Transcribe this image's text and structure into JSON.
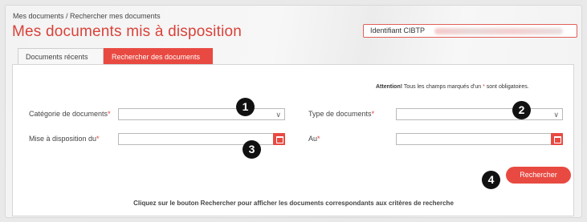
{
  "breadcrumb": "Mes documents / Rechercher mes documents",
  "page_title": "Mes documents mis à disposition",
  "identifier": {
    "label": "Identifiant CIBTP"
  },
  "tabs": [
    {
      "label": "Documents récents",
      "active": false
    },
    {
      "label": "Rechercher des documents",
      "active": true
    }
  ],
  "warning": {
    "bold": "Attention!",
    "text_before": " Tous les champs marqués d'un ",
    "star": "*",
    "text_after": " sont obligatoires."
  },
  "form": {
    "category_label": "Catégorie de documents",
    "type_label": "Type de documents",
    "date_from_label": "Mise à disposition du",
    "date_to_label": "Au",
    "required_marker": "*",
    "chevron": "∨"
  },
  "search_button": "Rechercher",
  "footer_hint": "Cliquez sur le bouton Rechercher pour afficher les documents correspondants aux critères de recherche",
  "badges": [
    "1",
    "2",
    "3",
    "4"
  ],
  "colors": {
    "accent": "#e84a42",
    "title": "#d9423a",
    "badge": "#111111"
  }
}
